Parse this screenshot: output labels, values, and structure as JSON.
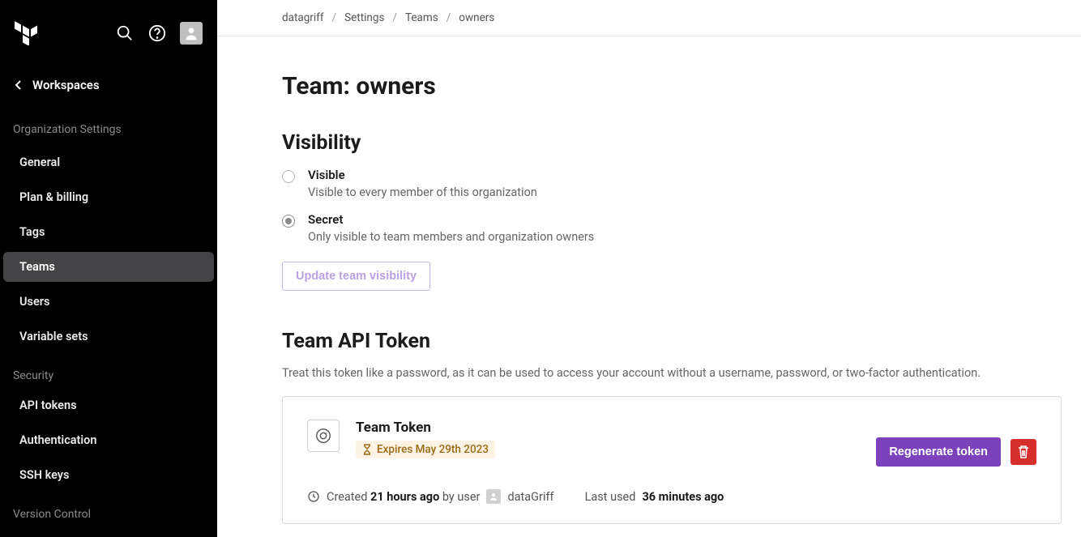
{
  "sidebar": {
    "back_label": "Workspaces",
    "heading": "Organization Settings",
    "items": [
      {
        "label": "General"
      },
      {
        "label": "Plan & billing"
      },
      {
        "label": "Tags"
      },
      {
        "label": "Teams",
        "active": true
      },
      {
        "label": "Users"
      },
      {
        "label": "Variable sets"
      }
    ],
    "security_heading": "Security",
    "security_items": [
      {
        "label": "API tokens"
      },
      {
        "label": "Authentication"
      },
      {
        "label": "SSH keys"
      }
    ],
    "vcs_heading": "Version Control"
  },
  "breadcrumbs": {
    "items": [
      "datagriff",
      "Settings",
      "Teams",
      "owners"
    ]
  },
  "page": {
    "title": "Team: owners",
    "visibility": {
      "heading": "Visibility",
      "options": [
        {
          "label": "Visible",
          "desc": "Visible to every member of this organization",
          "selected": false
        },
        {
          "label": "Secret",
          "desc": "Only visible to team members and organization owners",
          "selected": true
        }
      ],
      "button": "Update team visibility"
    },
    "token": {
      "heading": "Team API Token",
      "desc": "Treat this token like a password, as it can be used to access your account without a username, password, or two-factor authentication.",
      "name": "Team Token",
      "expires": "Expires May 29th 2023",
      "regenerate": "Regenerate token",
      "created_prefix": "Created ",
      "created_rel": "21 hours ago",
      "created_by_prefix": " by user ",
      "created_by": "dataGriff",
      "lastused_prefix": "Last used ",
      "lastused_rel": "36 minutes ago"
    }
  },
  "colors": {
    "accent": "#7b42bc",
    "danger": "#d62d2d",
    "warn_bg": "#fdf3e4",
    "warn_fg": "#9a6a15"
  }
}
